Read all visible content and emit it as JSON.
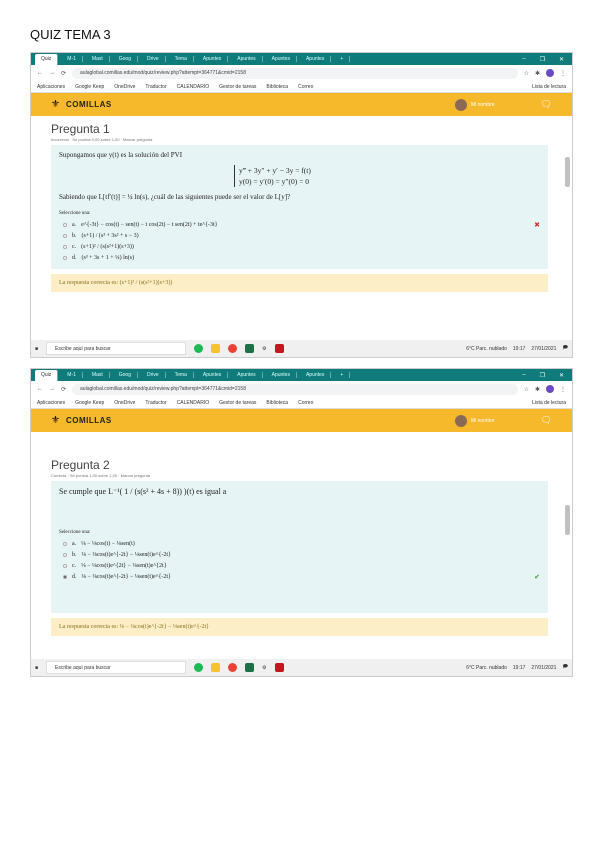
{
  "doc_title": "QUIZ TEMA 3",
  "browser": {
    "tabs": [
      "Quiz",
      "M-1",
      "Mast",
      "Goog",
      "Drive",
      "Tema",
      "Apuntes",
      "Apuntes",
      "Apuntes",
      "Apuntes"
    ],
    "new_tab": "+",
    "url": "aulaglobal.comillas.edu/mod/quiz/review.php?attempt=364771&cmid=2158",
    "bookmarks": [
      "Aplicaciones",
      "Google Keep",
      "OneDrive",
      "Traductor",
      "CALENDARIO",
      "Gestor de tareas",
      "Biblioteca",
      "Correo"
    ],
    "reading_list": "Lista de lectura"
  },
  "site": {
    "logo": "COMILLAS",
    "user": "Mi nombre"
  },
  "q1": {
    "title": "Pregunta 1",
    "meta": "Incorrecta · Se puntúa 0,00 sobre 1,00 · Marcar pregunta",
    "text": "Supongamos que y(t) es la solución del PVI",
    "eq1": "y‴ + 3y″ + y′ − 3y = f(t)",
    "eq2": "y(0) = y′(0) = y″(0) = 0",
    "text2": "Sabiendo que L[tf′(t)] = ¼ ln(s), ¿cuál de las siguientes puede ser el valor de L[y]?",
    "select": "Seleccione una:",
    "options": [
      {
        "letter": "a.",
        "text": "e^{-3t} − cos(t) − sen(t) − t cos(2t) − t sen(2t) + te^{-3t}",
        "mark": "✖"
      },
      {
        "letter": "b.",
        "text": "(s+1) / (s³ + 3s² + s − 3)",
        "mark": ""
      },
      {
        "letter": "c.",
        "text": "(s+1)² / (s(s²+1)(s+3))",
        "mark": ""
      },
      {
        "letter": "d.",
        "text": "(s³ + 3s + 1 + ¼) ln(s)",
        "mark": ""
      }
    ],
    "answer_label": "La respuesta correcta es:",
    "answer": "(s+1)² / (s(s²+1)(s+3))"
  },
  "q2": {
    "title": "Pregunta 2",
    "meta": "Correcta · Se puntúa 1,00 sobre 1,00 · Marcar pregunta",
    "text": "Se cumple que L⁻¹( 1 / (s(s² + 4s + 8)) )(t) es igual a",
    "select": "Seleccione una:",
    "options": [
      {
        "letter": "a.",
        "text": "⅛ − ⅛cos(t) − ⅛sen(t)",
        "mark": ""
      },
      {
        "letter": "b.",
        "text": "⅛ − ⅛cos(t)e^{-2t} − ⅛sen(t)e^{-2t}",
        "mark": ""
      },
      {
        "letter": "c.",
        "text": "⅛ − ⅛cos(t)e^{2t} − ⅛sen(t)e^{2t}",
        "mark": ""
      },
      {
        "letter": "d.",
        "text": "⅛ − ⅛cos(t)e^{-2t} − ⅛sen(t)e^{-2t}",
        "mark": "✔"
      }
    ],
    "answer_label": "La respuesta correcta es:",
    "answer": "⅛ − ⅛cos(t)e^{-2t} − ⅛sen(t)e^{-2t}"
  },
  "taskbar": {
    "search": "Escribe aquí para buscar",
    "weather": "6°C Parc. nublado",
    "time": "19:17",
    "date": "27/01/2021"
  }
}
